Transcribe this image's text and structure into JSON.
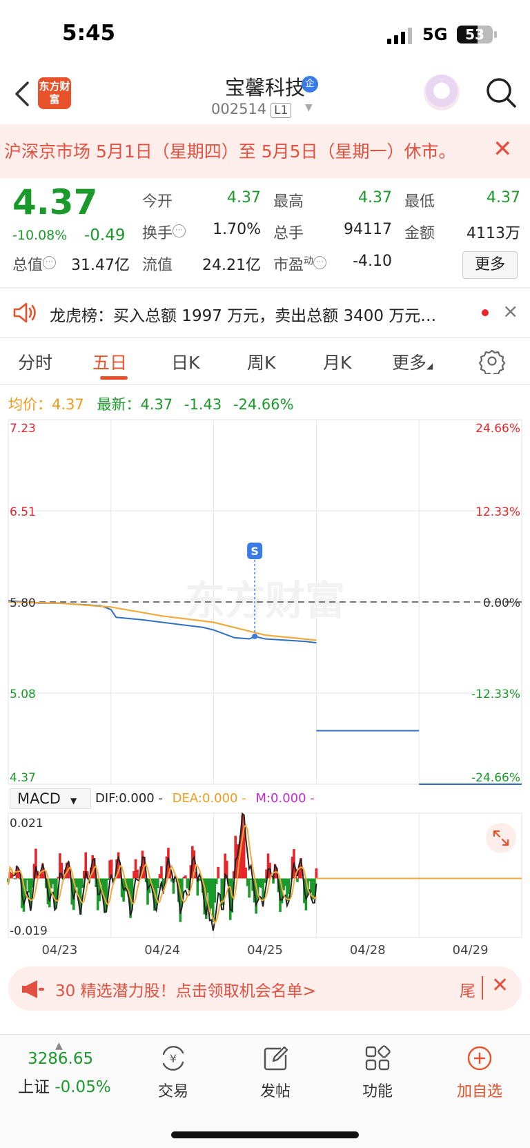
{
  "status": {
    "time": "5:45",
    "network": "5G",
    "battery": "53"
  },
  "header": {
    "logo_text": "东方财富",
    "stock_name": "宝馨科技",
    "verify_badge": "企",
    "stock_code": "002514",
    "level": "L1"
  },
  "notice": {
    "text": "沪深京市场 5月1日（星期四）至 5月5日（星期一）休市。",
    "close": "✕"
  },
  "quote": {
    "price": "4.37",
    "change_pct": "-10.08%",
    "change": "-0.49",
    "fields": {
      "open_label": "今开",
      "open": "4.37",
      "high_label": "最高",
      "high": "4.37",
      "low_label": "最低",
      "low": "4.37",
      "turnover_label": "换手",
      "turnover": "1.70%",
      "volume_label": "总手",
      "volume": "94117",
      "amount_label": "金额",
      "amount": "4113万",
      "mktcap_label": "总值",
      "mktcap": "31.47亿",
      "float_label": "流值",
      "float": "24.21亿",
      "pe_label": "市盈",
      "pe_sup": "动",
      "pe": "-4.10"
    },
    "more_label": "更多"
  },
  "lhb": {
    "text": "龙虎榜：买入总额 1997 万元，卖出总额 3400 万元…",
    "close": "×"
  },
  "tabs": [
    "分时",
    "五日",
    "日K",
    "周K",
    "月K",
    "更多"
  ],
  "active_tab": 1,
  "chart_header": {
    "avg_label": "均价：",
    "avg": "4.37",
    "latest_label": "最新：",
    "latest": "4.37",
    "change": "-1.43",
    "change_pct": "-24.66%"
  },
  "watermark": "东方财富",
  "chart_data": [
    {
      "type": "line",
      "title": "",
      "x_labels": [
        "04/23",
        "04/24",
        "04/25",
        "04/28",
        "04/29"
      ],
      "y_left_ticks": [
        "7.23",
        "6.51",
        "5.80",
        "5.08",
        "4.37"
      ],
      "y_right_ticks": [
        "24.66%",
        "12.33%",
        "0.00%",
        "-12.33%",
        "-24.66%"
      ],
      "ylim": [
        4.37,
        7.23
      ],
      "prev_close": 5.8,
      "series": [
        {
          "name": "price",
          "color": "#2c6fc4",
          "x_day": [
            0,
            0.15,
            0.3,
            0.5,
            0.7,
            0.9,
            1,
            1.05,
            1.3,
            1.6,
            1.9,
            2,
            2.2,
            2.35,
            2.4,
            2.5,
            2.7,
            2.9,
            3.0
          ],
          "values": [
            5.81,
            5.8,
            5.79,
            5.79,
            5.78,
            5.77,
            5.74,
            5.68,
            5.66,
            5.63,
            5.6,
            5.58,
            5.52,
            5.51,
            5.53,
            5.51,
            5.5,
            5.49,
            5.48
          ]
        },
        {
          "name": "avg",
          "color": "#f2a93b",
          "x_day": [
            0,
            0.5,
            1,
            1.5,
            2,
            2.5,
            3.0
          ],
          "values": [
            5.8,
            5.79,
            5.76,
            5.69,
            5.64,
            5.54,
            5.5
          ]
        },
        {
          "name": "limit",
          "color": "#2c6fc4",
          "x_day": [
            3.0,
            4.0
          ],
          "values": [
            4.79,
            4.79
          ]
        },
        {
          "name": "limit2",
          "color": "#2c6fc4",
          "x_day": [
            4.0,
            5.0
          ],
          "values": [
            4.37,
            4.37
          ]
        }
      ],
      "marker": {
        "label": "S",
        "x_day": 2.4,
        "value": 5.53
      }
    },
    {
      "type": "bar",
      "title": "MACD",
      "series_labels": {
        "dif": "DIF:0.000 -",
        "dea": "DEA:0.000 -",
        "m": "M:0.000 -"
      },
      "y_ticks": [
        "0.021",
        "-0.019"
      ],
      "ylim": [
        -0.019,
        0.021
      ],
      "colors": {
        "up": "#e8262a",
        "down": "#1a9a2a",
        "dif": "#222222",
        "dea": "#f2a93b",
        "m": "#c02cc9"
      }
    }
  ],
  "macd_select": "MACD",
  "promo": {
    "text": "30 精选潜力股！点击领取机会名单>",
    "tail": "尾",
    "close": "✕"
  },
  "bottom_nav": {
    "index_value": "3286.65",
    "index_name": "上证",
    "index_change": "-0.05%",
    "items": [
      "交易",
      "发帖",
      "功能",
      "加自选"
    ]
  }
}
